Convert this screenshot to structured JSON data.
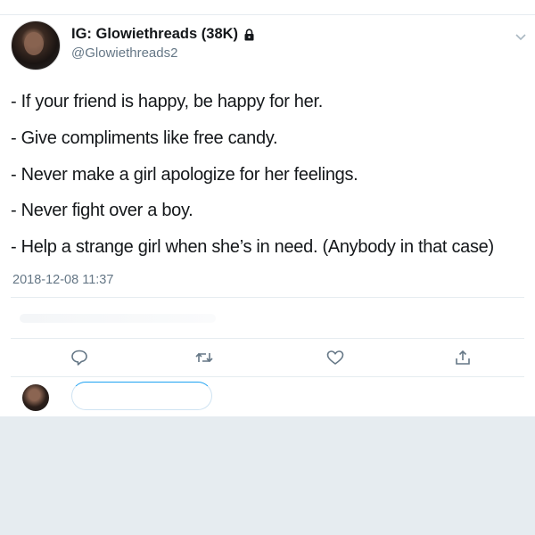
{
  "author": {
    "display_name": "IG: Glowiethreads (38K)",
    "handle": "@Glowiethreads2",
    "protected": true
  },
  "tweet": {
    "lines": [
      "- If your friend is happy, be happy for her.",
      "- Give compliments like free candy.",
      "- Never make a girl apologize for her feelings.",
      "- Never fight over a boy.",
      "- Help a strange girl when she’s in need. (Anybody in that case)"
    ],
    "timestamp": "2018-12-08 11:37"
  },
  "actions": {
    "icons": [
      "reply-icon",
      "retweet-icon",
      "like-icon",
      "share-icon"
    ],
    "icon_color": "#657786"
  },
  "reply": {
    "input_placeholder": ""
  },
  "colors": {
    "text": "#14171a",
    "secondary": "#657786",
    "divider": "#e6ecf0",
    "accent": "#1da1f2"
  }
}
